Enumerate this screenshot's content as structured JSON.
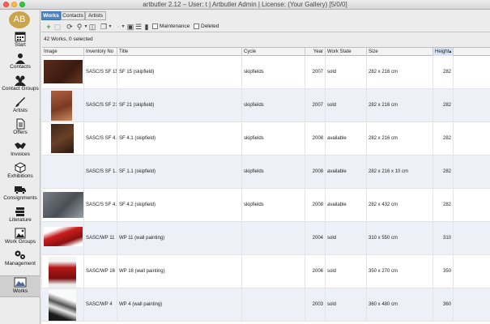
{
  "window": {
    "title": "artbutler 2.12 – User: t | Artbutler Admin | License: (Your Gallery) [5/0/0]"
  },
  "sidebar": {
    "avatar_initials": "AB",
    "items": [
      {
        "label": "Start",
        "icon": "calendar-icon"
      },
      {
        "label": "Contacts",
        "icon": "person-icon"
      },
      {
        "label": "Contact Groups",
        "icon": "group-icon"
      },
      {
        "label": "Artists",
        "icon": "brush-icon"
      },
      {
        "label": "Offers",
        "icon": "document-icon"
      },
      {
        "label": "Invoices",
        "icon": "handshake-icon"
      },
      {
        "label": "Exhibitions",
        "icon": "box-icon"
      },
      {
        "label": "Consignments",
        "icon": "truck-icon"
      },
      {
        "label": "Literature",
        "icon": "books-icon"
      },
      {
        "label": "Work Groups",
        "icon": "images-icon"
      },
      {
        "label": "Management",
        "icon": "gears-icon"
      },
      {
        "label": "Works",
        "icon": "works-icon"
      }
    ],
    "active": "Works"
  },
  "tabs": [
    "Works",
    "Contacts",
    "Artists"
  ],
  "toolbar": {
    "maintenance_label": "Maintenance",
    "deleted_label": "Deleted"
  },
  "summary": "42 Works, 0 selected",
  "table": {
    "columns": [
      "Image",
      "Inventory No",
      "Title",
      "Cycle",
      "Year",
      "Work State",
      "Size",
      "Height"
    ],
    "sorted_column": "Height",
    "rows": [
      {
        "inventory": "SASC/S SF 15",
        "title": "SF 15 (skipfield)",
        "cycle": "skipfields",
        "year": "2007",
        "state": "sold",
        "size": "282 x 216 cm",
        "height": "282",
        "thumb": "dark-red-landscape"
      },
      {
        "inventory": "SASC/S SF 21",
        "title": "SF 21 (skipfield)",
        "cycle": "skipfields",
        "year": "2007",
        "state": "sold",
        "size": "282 x 216 cm",
        "height": "282",
        "thumb": "rust-portrait"
      },
      {
        "inventory": "SASC/S SF 4.1",
        "title": "SF 4.1 (skipfield)",
        "cycle": "skipfields",
        "year": "2008",
        "state": "available",
        "size": "282 x 216 cm",
        "height": "282",
        "thumb": "dark-brown-portrait"
      },
      {
        "inventory": "SASC/S SF 1.1",
        "title": "SF 1.1 (skipfield)",
        "cycle": "skipfields",
        "year": "2008",
        "state": "available",
        "size": "282 x 216 x 10 cm",
        "height": "282",
        "thumb": ""
      },
      {
        "inventory": "SASC/S SF 4.2",
        "title": "SF 4.2 (skipfield)",
        "cycle": "skipfields",
        "year": "2008",
        "state": "available",
        "size": "282 x 432 cm",
        "height": "282",
        "thumb": "grey-landscape"
      },
      {
        "inventory": "SASC/WP 11",
        "title": "WP 11 (wall painting)",
        "cycle": "",
        "year": "2004",
        "state": "sold",
        "size": "310 x 550 cm",
        "height": "310",
        "thumb": "red-installation"
      },
      {
        "inventory": "SASC/WP 16",
        "title": "WP 16 (wall painting)",
        "cycle": "",
        "year": "2006",
        "state": "sold",
        "size": "350 x 270 cm",
        "height": "350",
        "thumb": "red-room"
      },
      {
        "inventory": "SASC/WP 4",
        "title": "WP 4 (wall painting)",
        "cycle": "",
        "year": "2003",
        "state": "sold",
        "size": "360 x 480 cm",
        "height": "360",
        "thumb": "white-room"
      }
    ]
  }
}
